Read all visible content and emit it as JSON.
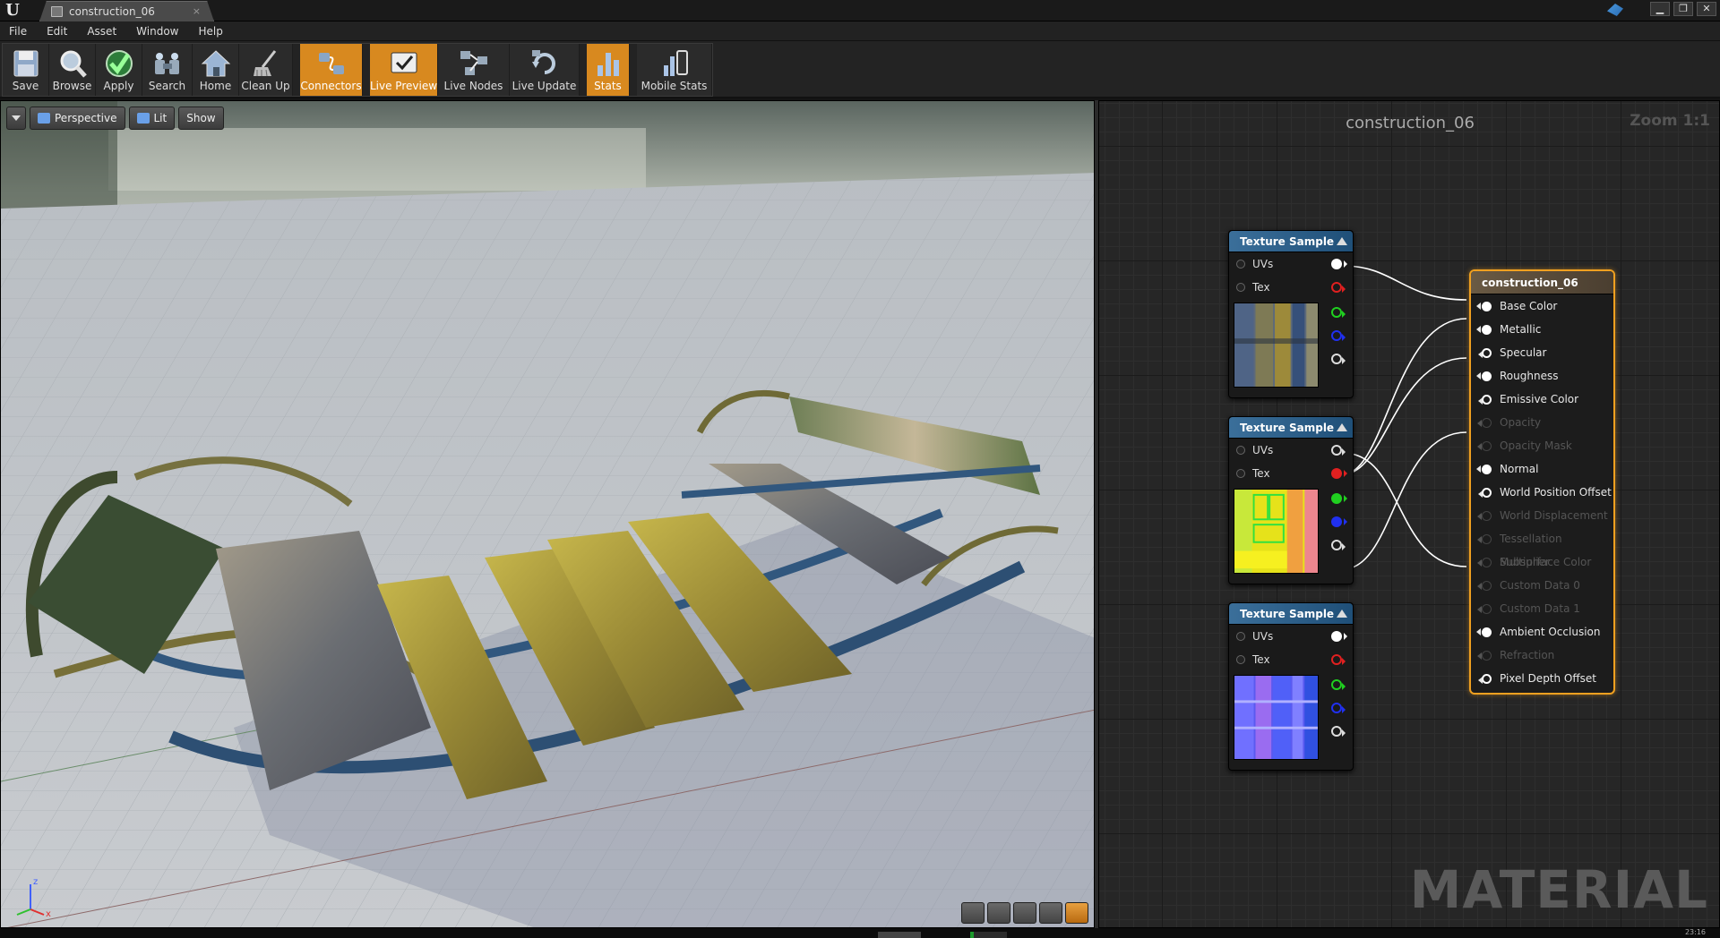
{
  "window": {
    "tab_title": "construction_06",
    "tab_close": "×",
    "buttons": [
      "▁",
      "❐",
      "✕"
    ]
  },
  "menu": [
    "File",
    "Edit",
    "Asset",
    "Window",
    "Help"
  ],
  "toolbar": [
    {
      "label": "Save",
      "icon": "save-icon",
      "active": false
    },
    {
      "label": "Browse",
      "icon": "browse-icon",
      "active": false
    },
    {
      "label": "Apply",
      "icon": "apply-icon",
      "active": false
    },
    {
      "label": "Search",
      "icon": "search-icon",
      "active": false
    },
    {
      "label": "Home",
      "icon": "home-icon",
      "active": false
    },
    {
      "label": "Clean Up",
      "icon": "clean-up-icon",
      "active": false
    },
    {
      "label": "Connectors",
      "icon": "connectors-icon",
      "active": true
    },
    {
      "label": "Live Preview",
      "icon": "live-preview-icon",
      "active": true
    },
    {
      "label": "Live Nodes",
      "icon": "live-nodes-icon",
      "active": false
    },
    {
      "label": "Live Update",
      "icon": "live-update-icon",
      "active": false
    },
    {
      "label": "Stats",
      "icon": "stats-icon",
      "active": true
    },
    {
      "label": "Mobile Stats",
      "icon": "mobile-stats-icon",
      "active": false
    }
  ],
  "viewport": {
    "perspective_label": "Perspective",
    "lit_label": "Lit",
    "show_label": "Show",
    "axis_x": "x",
    "axis_z": "z"
  },
  "graph": {
    "title": "construction_06",
    "zoom": "Zoom 1:1",
    "watermark": "MATERIAL"
  },
  "texture_nodes": [
    {
      "title": "Texture Sample",
      "inputs": [
        "UVs",
        "Tex"
      ],
      "outputs": [
        "white-filled",
        "red-ring",
        "green-ring",
        "blue-ring",
        "white-ring"
      ],
      "thumbnail": "base-color-texture"
    },
    {
      "title": "Texture Sample",
      "inputs": [
        "UVs",
        "Tex"
      ],
      "outputs": [
        "white-ring",
        "red-filled",
        "green-filled",
        "blue-filled",
        "white-ring"
      ],
      "thumbnail": "packed-mask-texture"
    },
    {
      "title": "Texture Sample",
      "inputs": [
        "UVs",
        "Tex"
      ],
      "outputs": [
        "white-filled",
        "red-ring",
        "green-ring",
        "blue-ring",
        "white-ring"
      ],
      "thumbnail": "normal-map-texture"
    }
  ],
  "result_node": {
    "title": "construction_06",
    "pins": [
      {
        "label": "Base Color",
        "state": "connected"
      },
      {
        "label": "Metallic",
        "state": "connected"
      },
      {
        "label": "Specular",
        "state": "enabled"
      },
      {
        "label": "Roughness",
        "state": "connected"
      },
      {
        "label": "Emissive Color",
        "state": "enabled"
      },
      {
        "label": "Opacity",
        "state": "disabled"
      },
      {
        "label": "Opacity Mask",
        "state": "disabled"
      },
      {
        "label": "Normal",
        "state": "connected"
      },
      {
        "label": "World Position Offset",
        "state": "enabled"
      },
      {
        "label": "World Displacement",
        "state": "disabled"
      },
      {
        "label": "Tessellation Multiplier",
        "state": "disabled"
      },
      {
        "label": "Subsurface Color",
        "state": "disabled"
      },
      {
        "label": "Custom Data 0",
        "state": "disabled"
      },
      {
        "label": "Custom Data 1",
        "state": "disabled"
      },
      {
        "label": "Ambient Occlusion",
        "state": "connected"
      },
      {
        "label": "Refraction",
        "state": "disabled"
      },
      {
        "label": "Pixel Depth Offset",
        "state": "enabled"
      }
    ]
  },
  "colors": {
    "accent_orange": "#d8891f",
    "node_header_blue": "#3b6f9a",
    "result_border": "#f0a020",
    "pin_red": "#e02020",
    "pin_green": "#20d020",
    "pin_blue": "#2030f0"
  },
  "status": {
    "clock": "23:16"
  }
}
